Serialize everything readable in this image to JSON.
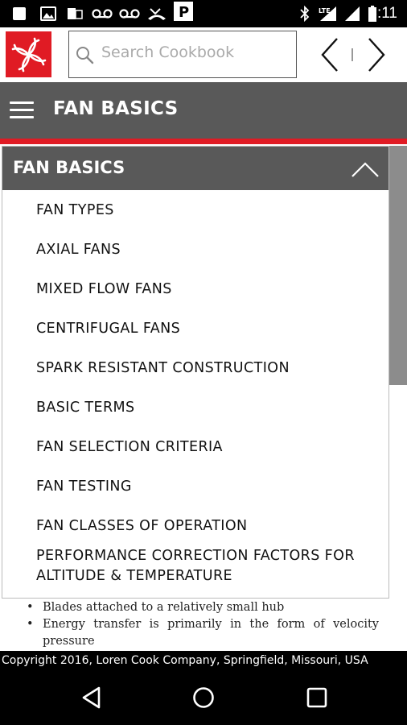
{
  "status_bar": {
    "time": "6:11",
    "lte": "LTE",
    "icons": [
      "square-icon",
      "image-icon",
      "sim-icon",
      "voicemail-icon",
      "voicemail-icon",
      "missed-call-icon",
      "parking-icon",
      "bluetooth-icon",
      "signal-icon",
      "battery-icon"
    ]
  },
  "search": {
    "placeholder": "Search Cookbook"
  },
  "header": {
    "title": "FAN BASICS"
  },
  "panel": {
    "title": "FAN BASICS",
    "items": [
      "FAN TYPES",
      "AXIAL FANS",
      "MIXED FLOW FANS",
      "CENTRIFUGAL FANS",
      "SPARK RESISTANT CONSTRUCTION",
      "BASIC TERMS",
      "FAN SELECTION CRITERIA",
      "FAN TESTING",
      "FAN CLASSES OF OPERATION",
      "PERFORMANCE CORRECTION FACTORS FOR ALTITUDE & TEMPERATURE"
    ]
  },
  "background_text": {
    "bullets": [
      "Blades attached to a relatively small hub",
      "Energy transfer is primarily in the form of velocity pressure"
    ]
  },
  "footer": {
    "text": "Copyright 2016, Loren Cook Company, Springfield, Missouri, USA"
  },
  "colors": {
    "accent": "#e01b24",
    "header_bg": "#595959",
    "scroll_thumb": "#8c8c8c"
  }
}
